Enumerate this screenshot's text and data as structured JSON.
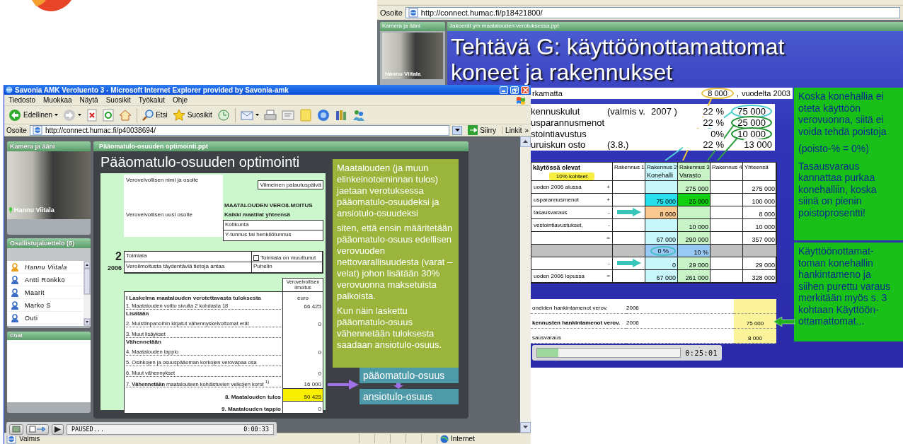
{
  "back_window": {
    "address": {
      "label": "Osoite",
      "url": "http://connect.humac.fi/p18421800/"
    },
    "camera": {
      "title": "Kamera ja ääni",
      "presenter": "Hannu Viitala"
    },
    "slide_tab": "Jakoerät ym maatalouden verotuksessa.ppt",
    "slide": {
      "title_lines": [
        "Tehtävä G: käyttöönottamattomat",
        "koneet ja rakennukset"
      ],
      "carryover": {
        "label": "rkamatta",
        "amount": "8 000",
        "ring": {
          "color": "#e8c040"
        },
        "suffix": ",",
        "note": "vuodelta 2003"
      },
      "cost_rows": [
        {
          "label": "kennuskulut",
          "detail": "(valmis v.",
          "year": "2007 )",
          "percent": "22 %",
          "amount": "75 000",
          "ring": {
            "color": "#48cccc"
          }
        },
        {
          "label": "usparannusmenot",
          "percent": "22 %",
          "amount": "25 000",
          "ring": {
            "color": "#209030"
          }
        },
        {
          "label": "stointiavustus",
          "percent": "0%",
          "amount": "10 000",
          "ring": {
            "color": "#209030"
          }
        },
        {
          "label": "uruiskun osto",
          "detail": "(3.8.)",
          "percent": "22 %",
          "amount": "13 000"
        }
      ],
      "table": {
        "label_header": "käytössä olevat",
        "badge": "10% kohteet",
        "columns": [
          {
            "title": "Rakennus 1"
          },
          {
            "title": "Rakennus 2",
            "subtitle": "Konehalli",
            "color": "#c8f6fa"
          },
          {
            "title": "Rakennus 3",
            "subtitle": "Varasto",
            "color": "#c8f4c8"
          },
          {
            "title": "Rakennus 4"
          },
          {
            "title": "Yhteensä"
          }
        ],
        "rows": [
          {
            "label": "uoden 2006 alussa",
            "sign": "+",
            "shaded": false,
            "cells": [
              null,
              null,
              {
                "text": "275 000"
              },
              null,
              {
                "text": "275 000"
              }
            ]
          },
          {
            "label": "usparannusmenot",
            "sign": "+",
            "shaded": false,
            "cells": [
              null,
              {
                "text": "75 000",
                "color": "#28e0ec"
              },
              {
                "text": "25 000",
                "color": "#10d010"
              },
              null,
              {
                "text": "100 000"
              }
            ]
          },
          {
            "label": "tasausvaraus",
            "sign": "-",
            "shaded": false,
            "cells": [
              {
                "kind": "arrow"
              },
              {
                "text": "8 000",
                "color": "#f8c890"
              },
              null,
              null,
              {
                "text": "8 000"
              }
            ]
          },
          {
            "label": "vestointiavustukset,",
            "sign": "-",
            "shaded": false,
            "cells": [
              null,
              null,
              {
                "text": "10 000"
              },
              null,
              {
                "text": "10 000"
              }
            ]
          },
          {
            "sign": "=",
            "shaded": false,
            "cells": [
              null,
              {
                "text": "67 000"
              },
              {
                "text": "290 000"
              },
              null,
              {
                "text": "357 000"
              }
            ]
          },
          {
            "shaded": true,
            "cells": [
              null,
              {
                "text": "0 %",
                "color": "#98c8f4",
                "ring": {
                  "color": "#40c0c0"
                }
              },
              {
                "text": "10 %",
                "color": "#98c8f4"
              },
              null,
              null
            ]
          },
          {
            "sign": "-",
            "shaded": false,
            "cells": [
              {
                "kind": "arrow"
              },
              {
                "text": "0"
              },
              {
                "text": "29 000"
              },
              null,
              {
                "text": "29 000"
              }
            ]
          },
          {
            "label": "uoden 2006 lopussa",
            "sign": "=",
            "shaded": false,
            "cells": [
              null,
              {
                "text": "67 000"
              },
              {
                "text": "261 000"
              },
              null,
              {
                "text": "328 000"
              }
            ]
          }
        ]
      },
      "lower_rows": [
        {
          "label": "oneiden hankintamenot verov.",
          "year": "2006",
          "bold": false,
          "pointer": false
        },
        {
          "label": "kennusten hankintamenot verov.",
          "year": "2006",
          "value": "75 000",
          "bold": true,
          "pointer": true
        },
        {
          "label": "sausvaraus",
          "value": "8 000",
          "bold": false,
          "pointer": false
        }
      ],
      "notes": [
        "Koska konehallia ei oteta käyttöön verovuonna, siitä ei voida tehdä poistoja",
        "(poisto-% = 0%)",
        "Tasausvaraus kannattaa purkaa konehalliin, koska siinä on pienin poistoprosentti!"
      ],
      "note2": "Käyttöönottamat-toman konehallin hankintameno ja siihen purettu varaus merkitään myös s. 3 kohtaan Käyttöön-ottamattomat..."
    },
    "playback": {
      "level": 0.15,
      "time": "0:25:01"
    }
  },
  "front_window": {
    "title": "Savonia AMK Veroluento 3 - Microsoft Internet Explorer provided by Savonia-amk",
    "menu": [
      "Tiedosto",
      "Muokkaa",
      "Näytä",
      "Suosikit",
      "Työkalut",
      "Ohje"
    ],
    "toolbar": {
      "back": "Edellinen",
      "search": "Etsi",
      "favorites": "Suosikit"
    },
    "address": {
      "label": "Osoite",
      "url": "http://connect.humac.fi/p40038694/",
      "go": "Siirry",
      "links": "Linkit",
      "more": "»"
    },
    "camera": {
      "title": "Kamera ja ääni",
      "presenter": "Hannu Viitala"
    },
    "participants": {
      "title": "Osallistujaluettelo (8)",
      "items": [
        {
          "name": "Hannu Viitala",
          "kind": "host"
        },
        {
          "name": "Antti Rönkkö",
          "kind": "participant"
        },
        {
          "name": "Maarit",
          "kind": "participant"
        },
        {
          "name": "Marko S",
          "kind": "participant"
        },
        {
          "name": "Outi",
          "kind": "participant"
        }
      ]
    },
    "chat": {
      "title": "Chat"
    },
    "slide_tab": "Pääomatulo-osuuden optimointi.ppt",
    "slide": {
      "title": "Pääomatulo-osuuden optimointi",
      "form": {
        "name_label": "Verovelvollisen nimi ja osoite",
        "address_label": "Verovelvollisen uusi osoite",
        "due_label": "Viimeinen palautuspäivä",
        "heading": "MAATALOUDEN VEROILMOITUS",
        "subheading": "Kaikki maatilat yhteensä",
        "fields": [
          "Kotikunta",
          "Y-tunnus tai henkilötunnus"
        ],
        "page": "2",
        "year": "2006",
        "industry_label": "Toimiala",
        "industry_changed": {
          "label": "Toimiala on muuttunut",
          "checked": false
        },
        "contact_label": "Veroilmoitusta täydentäviä tietoja antaa",
        "phone_label": "Puhelin",
        "calc_title": "I Laskelma maatalouden verotettavasta tuloksesta",
        "value_header": [
          "Verovelvollisen ilmoitus",
          "euro"
        ],
        "lines": [
          {
            "text": "1. Maatalouden voitto sivulta 2 kohdasta 18",
            "value": "66 425",
            "kind": "item"
          },
          {
            "text": "Lisätään",
            "kind": "heading"
          },
          {
            "text": "2. Muistiinpanoihin kirjatut vähennyskelvottomat erät",
            "value": "0",
            "kind": "item"
          },
          {
            "text": "3. Muut lisäykset",
            "kind": "item"
          },
          {
            "text": "Vähennetään",
            "kind": "heading"
          },
          {
            "text": "4. Maatalouden tappio",
            "value": "0",
            "kind": "item"
          },
          {
            "text": "5. Osinkojen ja osuuspääoman korkojen verovapaa osa",
            "kind": "item"
          },
          {
            "text": "6. Muut vähennykset",
            "value": "0",
            "kind": "item"
          },
          {
            "text": "7. **Vähennetään** maatalouteen kohdistuvien velkojen korot $^{1)}$",
            "value": "16 000",
            "kind": "item"
          },
          {
            "text": "8. Maatalouden tulos",
            "value": "50 425",
            "kind": "total",
            "highlight": true
          },
          {
            "text": "9. Maatalouden tappio",
            "value": "0",
            "kind": "total",
            "highlight": false
          }
        ]
      },
      "notes": [
        "Maatalouden (ja muun elinkeinotoiminnan tulos) jaetaan verotuksessa pääomatulo-osuudeksi ja ansiotulo-osuudeksi",
        "siten, että ensin määritetään pääomatulo-osuus edellisen verovuoden nettovarallisuudesta (varat – velat) johon lisätään 30% verovuonna maksetuista palkoista.",
        "Kun näin laskettu pääomatulo-osuus vähennetään tuloksesta saadaan ansiotulo-osuus."
      ],
      "result_boxes": [
        "pääomatulo-osuus",
        "ansiotulo-osuus"
      ]
    },
    "playback": {
      "status": "PAUSED...",
      "time": "0:00:33"
    },
    "status_bar": {
      "text": "Valmis",
      "zone": "Internet"
    }
  }
}
